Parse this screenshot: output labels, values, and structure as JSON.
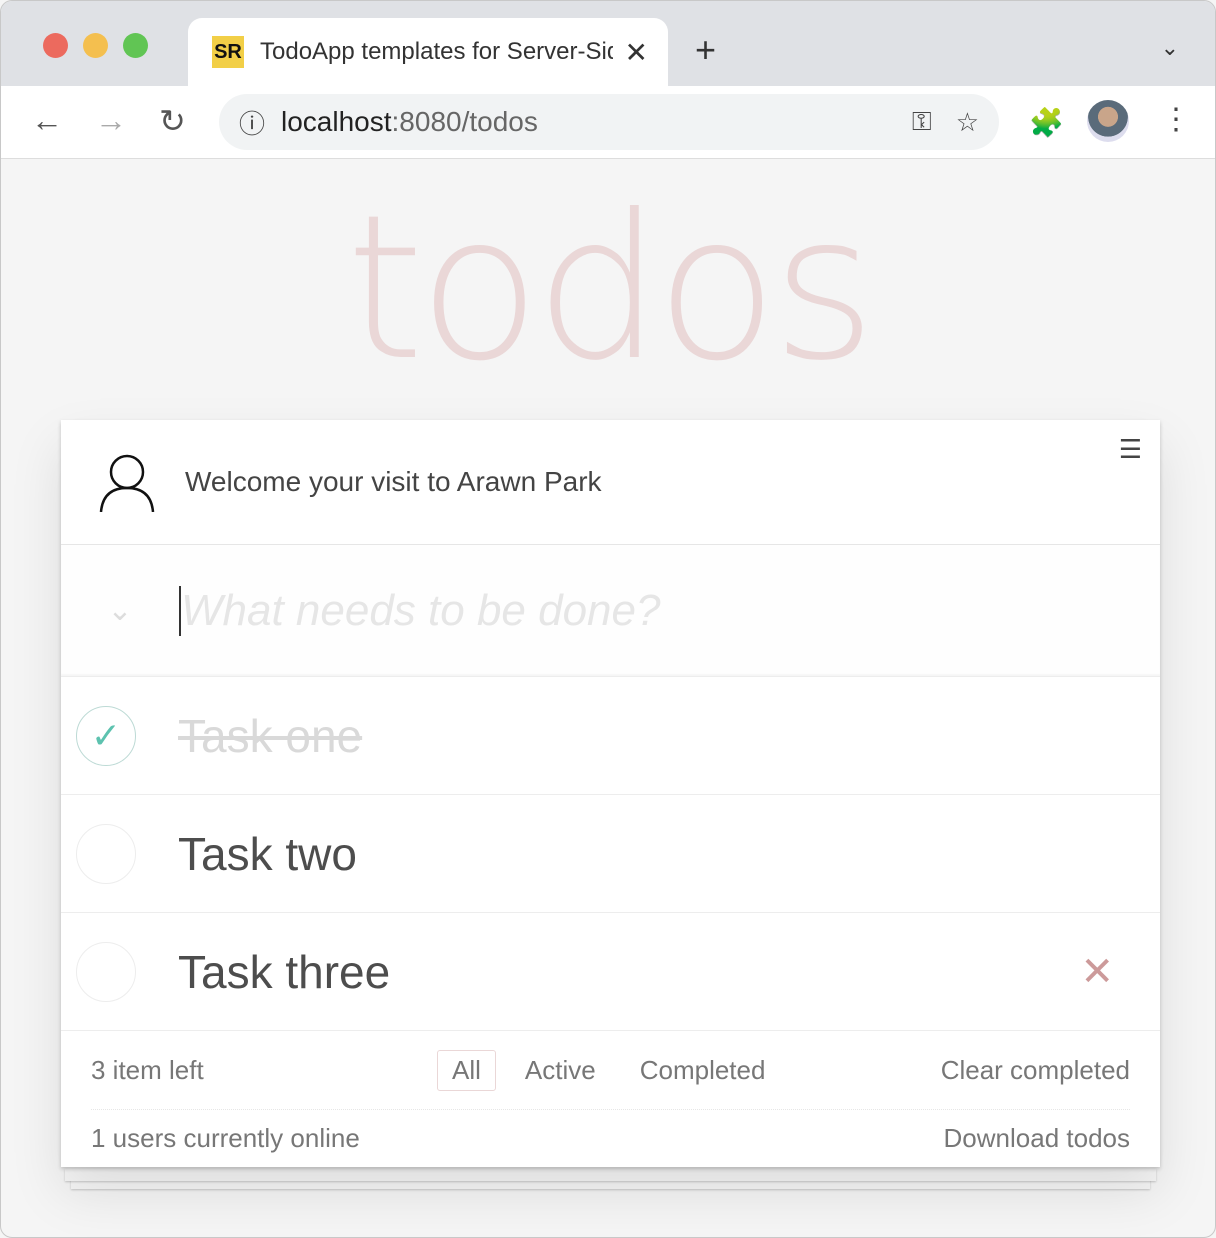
{
  "browser": {
    "tab_title": "TodoApp templates for Server-Side Rendering",
    "favicon_text": "SR",
    "url_host": "localhost",
    "url_path": ":8080/todos"
  },
  "app": {
    "title": "todos",
    "welcome": "Welcome your visit to Arawn Park",
    "input_placeholder": "What needs to be done?",
    "todos": [
      {
        "title": "Task one",
        "completed": true
      },
      {
        "title": "Task two",
        "completed": false
      },
      {
        "title": "Task three",
        "completed": false
      }
    ],
    "footer": {
      "count": "3 item left",
      "filters": [
        "All",
        "Active",
        "Completed"
      ],
      "selected_filter": "All",
      "clear": "Clear completed",
      "online": "1 users currently online",
      "download": "Download todos"
    }
  },
  "colors": {
    "title": "#ead7d7",
    "check": "#5dc2af",
    "destroy": "#cc9a9a"
  }
}
